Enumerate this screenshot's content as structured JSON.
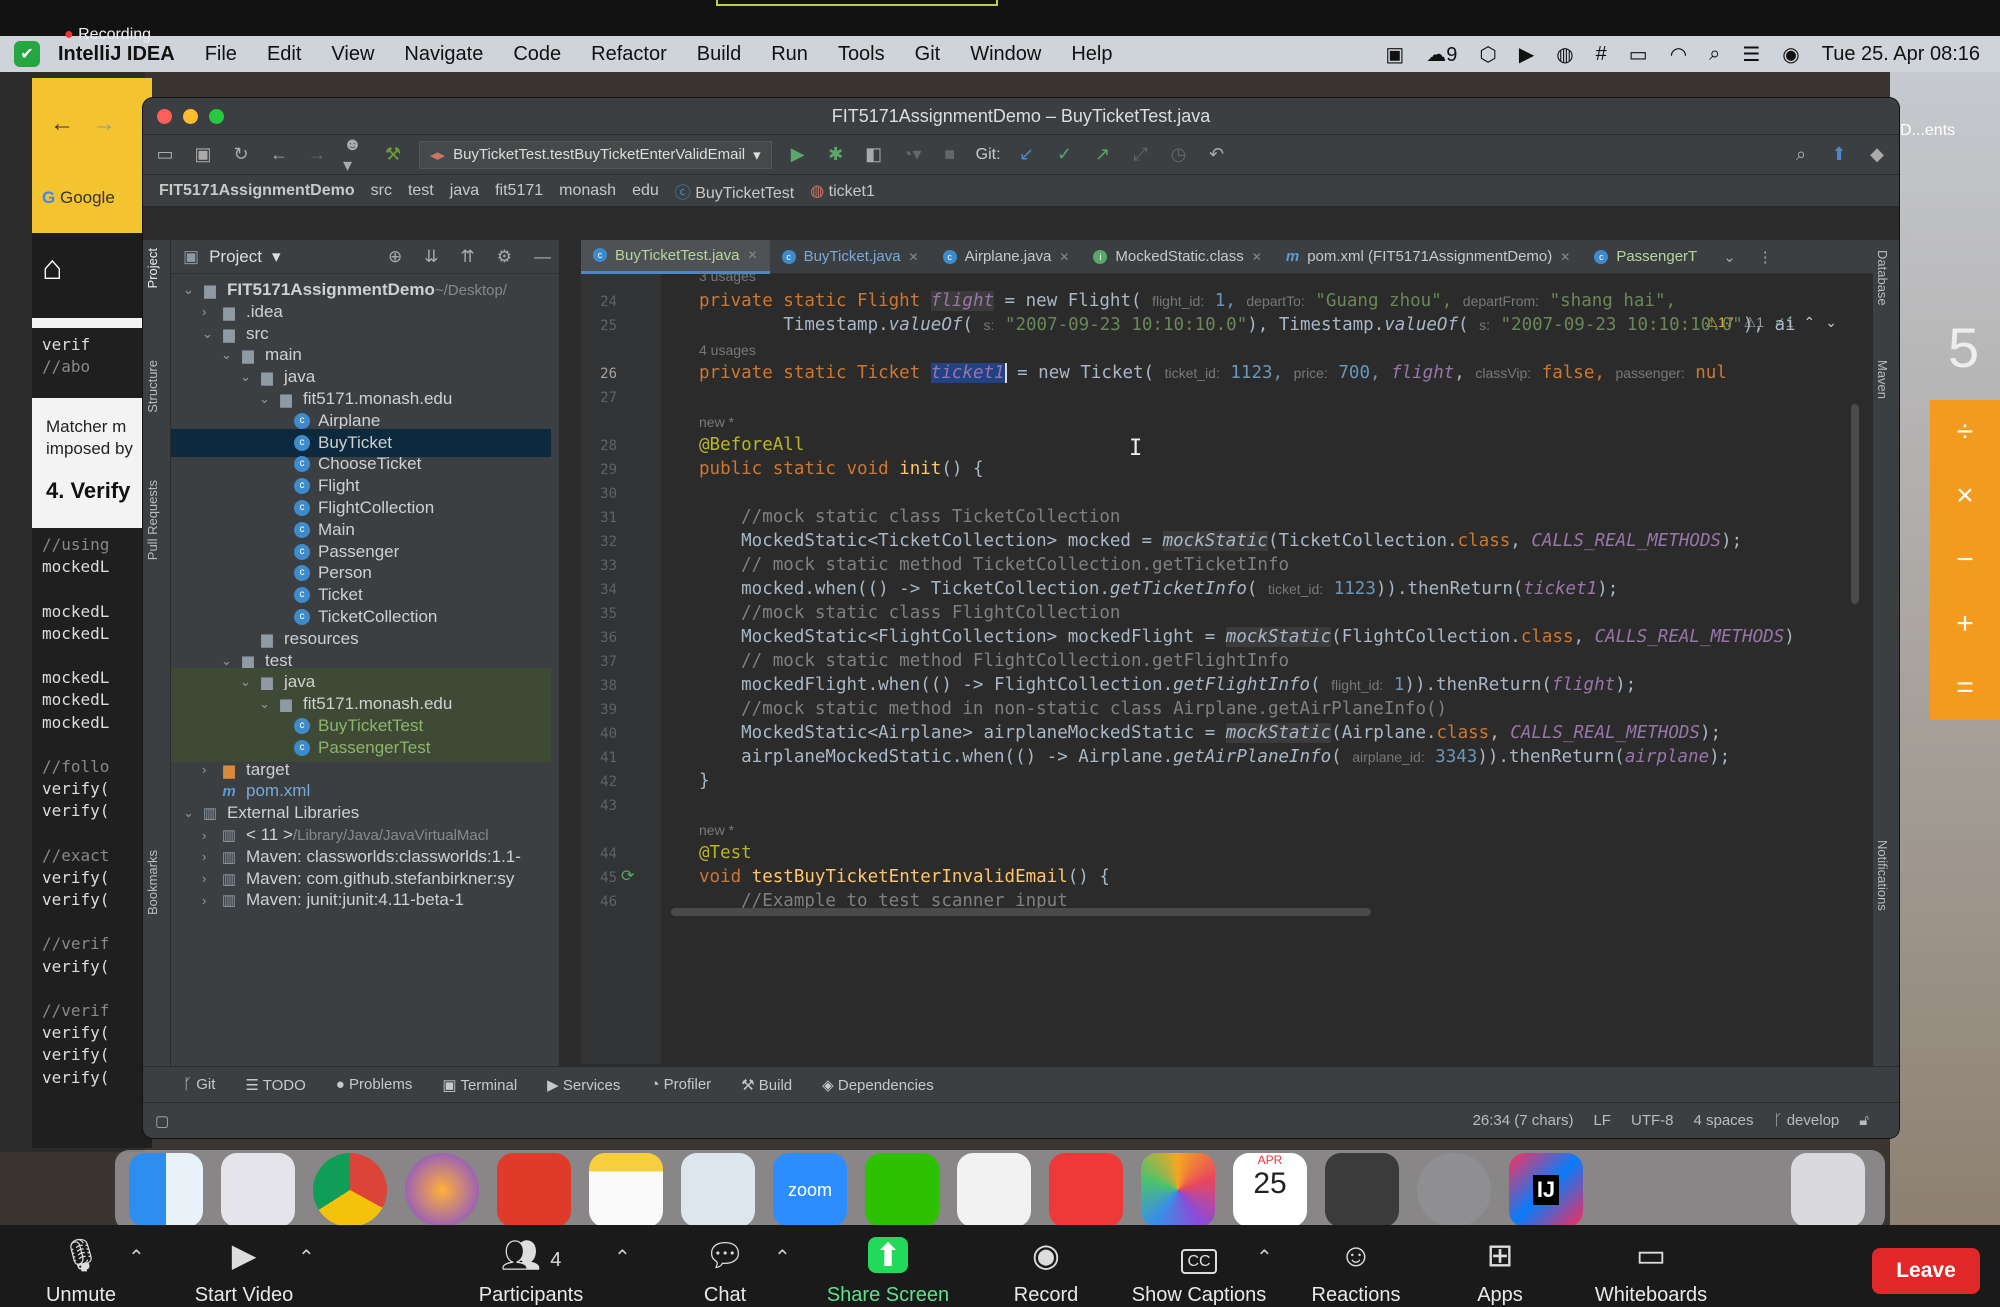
{
  "menubar": {
    "app": "IntelliJ IDEA",
    "recording": "Recording",
    "items": [
      "File",
      "Edit",
      "View",
      "Navigate",
      "Code",
      "Refactor",
      "Build",
      "Run",
      "Tools",
      "Git",
      "Window",
      "Help"
    ],
    "badge": "9",
    "datetime": "Tue 25. Apr  08:16"
  },
  "window": {
    "title": "FIT5171AssignmentDemo – BuyTicketTest.java"
  },
  "toolbar": {
    "run_config": "BuyTicketTest.testBuyTicketEnterValidEmail",
    "git_label": "Git:"
  },
  "breadcrumb": [
    "FIT5171AssignmentDemo",
    "src",
    "test",
    "java",
    "fit5171",
    "monash",
    "edu",
    "BuyTicketTest",
    "ticket1"
  ],
  "project": {
    "header": "Project",
    "tree": [
      {
        "label": "FIT5171AssignmentDemo",
        "suffix": " ~/Desktop/",
        "depth": 0,
        "icon": "folder",
        "arrow": "open",
        "bold": true
      },
      {
        "label": ".idea",
        "depth": 1,
        "icon": "folder",
        "arrow": "closed"
      },
      {
        "label": "src",
        "depth": 1,
        "icon": "folder",
        "arrow": "open"
      },
      {
        "label": "main",
        "depth": 2,
        "icon": "folder",
        "arrow": "open"
      },
      {
        "label": "java",
        "depth": 3,
        "icon": "folder",
        "arrow": "open"
      },
      {
        "label": "fit5171.monash.edu",
        "depth": 4,
        "icon": "folder",
        "arrow": "open"
      },
      {
        "label": "Airplane",
        "depth": 5,
        "icon": "class"
      },
      {
        "label": "BuyTicket",
        "depth": 5,
        "icon": "class",
        "selected": true
      },
      {
        "label": "ChooseTicket",
        "depth": 5,
        "icon": "class"
      },
      {
        "label": "Flight",
        "depth": 5,
        "icon": "class"
      },
      {
        "label": "FlightCollection",
        "depth": 5,
        "icon": "class"
      },
      {
        "label": "Main",
        "depth": 5,
        "icon": "class"
      },
      {
        "label": "Passenger",
        "depth": 5,
        "icon": "class"
      },
      {
        "label": "Person",
        "depth": 5,
        "icon": "class"
      },
      {
        "label": "Ticket",
        "depth": 5,
        "icon": "class"
      },
      {
        "label": "TicketCollection",
        "depth": 5,
        "icon": "class"
      },
      {
        "label": "resources",
        "depth": 3,
        "icon": "folder"
      },
      {
        "label": "test",
        "depth": 2,
        "icon": "folder",
        "arrow": "open"
      },
      {
        "label": "java",
        "depth": 3,
        "icon": "folder",
        "arrow": "open",
        "test": true
      },
      {
        "label": "fit5171.monash.edu",
        "depth": 4,
        "icon": "folder",
        "arrow": "open",
        "test": true
      },
      {
        "label": "BuyTicketTest",
        "depth": 5,
        "icon": "class",
        "test": true
      },
      {
        "label": "PassengerTest",
        "depth": 5,
        "icon": "class",
        "test": true
      },
      {
        "label": "target",
        "depth": 1,
        "icon": "target",
        "arrow": "closed"
      },
      {
        "label": "pom.xml",
        "depth": 1,
        "icon": "m"
      },
      {
        "label": "External Libraries",
        "depth": 0,
        "icon": "lib",
        "arrow": "open"
      },
      {
        "label": "< 11 >",
        "suffix": " /Library/Java/JavaVirtualMacl",
        "depth": 1,
        "icon": "lib",
        "arrow": "closed"
      },
      {
        "label": "Maven: classworlds:classworlds:1.1-",
        "depth": 1,
        "icon": "lib",
        "arrow": "closed"
      },
      {
        "label": "Maven: com.github.stefanbirkner:sy",
        "depth": 1,
        "icon": "lib",
        "arrow": "closed"
      },
      {
        "label": "Maven: junit:junit:4.11-beta-1",
        "depth": 1,
        "icon": "lib",
        "arrow": "closed"
      }
    ]
  },
  "tabs": [
    {
      "label": "BuyTicketTest.java",
      "active": true
    },
    {
      "label": "BuyTicket.java"
    },
    {
      "label": "Airplane.java"
    },
    {
      "label": "MockedStatic.class"
    },
    {
      "label": "pom.xml (FIT5171AssignmentDemo)"
    },
    {
      "label": "PassengerT"
    }
  ],
  "inspections": {
    "warnings": "17",
    "weak": "1",
    "ok": "1"
  },
  "code": {
    "usages3": "3 usages",
    "usages4": "4 usages",
    "new1": "new *",
    "new2": "new *",
    "lines": {
      "l24": "24",
      "l25": "25",
      "l26": "26",
      "l27": "27",
      "l28": "28",
      "l29": "29",
      "l30": "30",
      "l31": "31",
      "l32": "32",
      "l33": "33",
      "l34": "34",
      "l35": "35",
      "l36": "36",
      "l37": "37",
      "l38": "38",
      "l39": "39",
      "l40": "40",
      "l41": "41",
      "l42": "42",
      "l43": "43",
      "l44": "44",
      "l45": "45",
      "l46": "46"
    },
    "c24a": "private static Flight ",
    "c24b": "flight",
    "c24c": " = new Flight( ",
    "c24h1": "flight_id:",
    "c24n1": " 1, ",
    "c24h2": "departTo:",
    "c24s1": " \"Guang zhou\", ",
    "c24h3": "departFrom:",
    "c24s2": " \"shang hai\",",
    "c25a": "        Timestamp.",
    "c25b": "valueOf",
    "c25c": "( ",
    "c25h": "s:",
    "c25s": " \"2007-09-23 10:10:10.0\"",
    "c25d": "), Timestamp.",
    "c25e": "valueOf",
    "c25f": "( ",
    "c25h2": "s:",
    "c25s2": " \"2007-09-23 10:10:10.0\"",
    "c25g": "), ai",
    "c26a": "private static Ticket ",
    "c26b": "ticket1",
    "c26c": " = new Ticket( ",
    "c26h1": "ticket_id:",
    "c26n1": " 1123, ",
    "c26h2": "price:",
    "c26n2": " 700, ",
    "c26f": "flight",
    "c26d": ", ",
    "c26h3": "classVip:",
    "c26k": " false, ",
    "c26h4": "passenger:",
    "c26e": " nul",
    "c28": "@BeforeAll",
    "c29a": "public static void ",
    "c29b": "init",
    "c29c": "() {",
    "c31": "    //mock static class TicketCollection",
    "c32a": "    MockedStatic<TicketCollection> mocked = ",
    "c32b": "mockStatic",
    "c32c": "(TicketCollection.",
    "c32d": "class",
    "c32e": ", ",
    "c32f": "CALLS_REAL_METHODS",
    "c32g": ");",
    "c33": "    // mock static method TicketCollection.getTicketInfo",
    "c34a": "    mocked.when(() -> TicketCollection.",
    "c34b": "getTicketInfo",
    "c34c": "( ",
    "c34h": "ticket_id:",
    "c34n": " 1123",
    "c34d": ")).thenReturn(",
    "c34e": "ticket1",
    "c34f": ");",
    "c35": "    //mock static class FlightCollection",
    "c36a": "    MockedStatic<FlightCollection> mockedFlight = ",
    "c36b": "mockStatic",
    "c36c": "(FlightCollection.",
    "c36d": "class",
    "c36e": ", ",
    "c36f": "CALLS_REAL_METHODS",
    "c36g": ")",
    "c37": "    // mock static method FlightCollection.getFlightInfo",
    "c38a": "    mockedFlight.when(() -> FlightCollection.",
    "c38b": "getFlightInfo",
    "c38c": "( ",
    "c38h": "flight_id:",
    "c38n": " 1",
    "c38d": ")).thenReturn(",
    "c38e": "flight",
    "c38f": ");",
    "c39": "    //mock static method in non-static class Airplane.getAirPlaneInfo()",
    "c40a": "    MockedStatic<Airplane> airplaneMockedStatic = ",
    "c40b": "mockStatic",
    "c40c": "(Airplane.",
    "c40d": "class",
    "c40e": ", ",
    "c40f": "CALLS_REAL_METHODS",
    "c40g": ");",
    "c41a": "    airplaneMockedStatic.when(() -> Airplane.",
    "c41b": "getAirPlaneInfo",
    "c41c": "( ",
    "c41h": "airplane_id:",
    "c41n": " 3343",
    "c41d": ")).thenReturn(",
    "c41e": "airplane",
    "c41f": ");",
    "c42": "}",
    "c44": "@Test",
    "c45a": "void ",
    "c45b": "testBuyTicketEnterInvalidEmail",
    "c45c": "() {",
    "c46": "    //Example to test scanner input"
  },
  "bottom_tabs": [
    "Git",
    "TODO",
    "Problems",
    "Terminal",
    "Services",
    "Profiler",
    "Build",
    "Dependencies"
  ],
  "status": {
    "position": "26:34 (7 chars)",
    "line_sep": "LF",
    "encoding": "UTF-8",
    "indent": "4 spaces",
    "branch": "develop"
  },
  "side_tabs": {
    "project": "Project",
    "structure": "Structure",
    "pull": "Pull Requests",
    "bookmarks": "Bookmarks",
    "database": "Database",
    "maven": "Maven",
    "notifications": "Notifications"
  },
  "background": {
    "browser_google": "Google",
    "matcher_line1": "Matcher m",
    "matcher_line2": "imposed by",
    "verify_heading": "4. Verify",
    "code_top1": "verif",
    "code_top2": "//abo",
    "code_lines": [
      "//using",
      "mockedL",
      "",
      "mockedL",
      "mockedL",
      "",
      "mockedL",
      "mockedL",
      "mockedL",
      "",
      "//follo",
      "verify(",
      "verify(",
      "",
      "//exact",
      "verify(",
      "verify(",
      "",
      "//verif",
      "verify(",
      "",
      "//verif",
      "verify(",
      "verify(",
      "verify("
    ],
    "right_label": "D...ents",
    "calc_digit": "5",
    "calc_ops": [
      "÷",
      "×",
      "−",
      "+",
      "="
    ]
  },
  "zoom": {
    "items": [
      {
        "label": "Unmute",
        "icon": "mic-off-icon"
      },
      {
        "label": "Start Video",
        "icon": "video-off-icon"
      },
      {
        "label": "Participants",
        "icon": "participants-icon",
        "count": "4"
      },
      {
        "label": "Chat",
        "icon": "chat-icon"
      },
      {
        "label": "Share Screen",
        "icon": "share-screen-icon"
      },
      {
        "label": "Record",
        "icon": "record-icon"
      },
      {
        "label": "Show Captions",
        "icon": "captions-icon"
      },
      {
        "label": "Reactions",
        "icon": "reactions-icon"
      },
      {
        "label": "Apps",
        "icon": "apps-icon"
      },
      {
        "label": "Whiteboards",
        "icon": "whiteboards-icon"
      }
    ],
    "leave": "Leave",
    "captions_badge": "CC"
  },
  "dock": {
    "calendar_month": "APR",
    "calendar_day": "25",
    "zoom_label": "zoom",
    "ij_label": "IJ"
  },
  "colors": {
    "accent": "#4a88c7",
    "leave": "#e02828",
    "share": "#23d959"
  }
}
